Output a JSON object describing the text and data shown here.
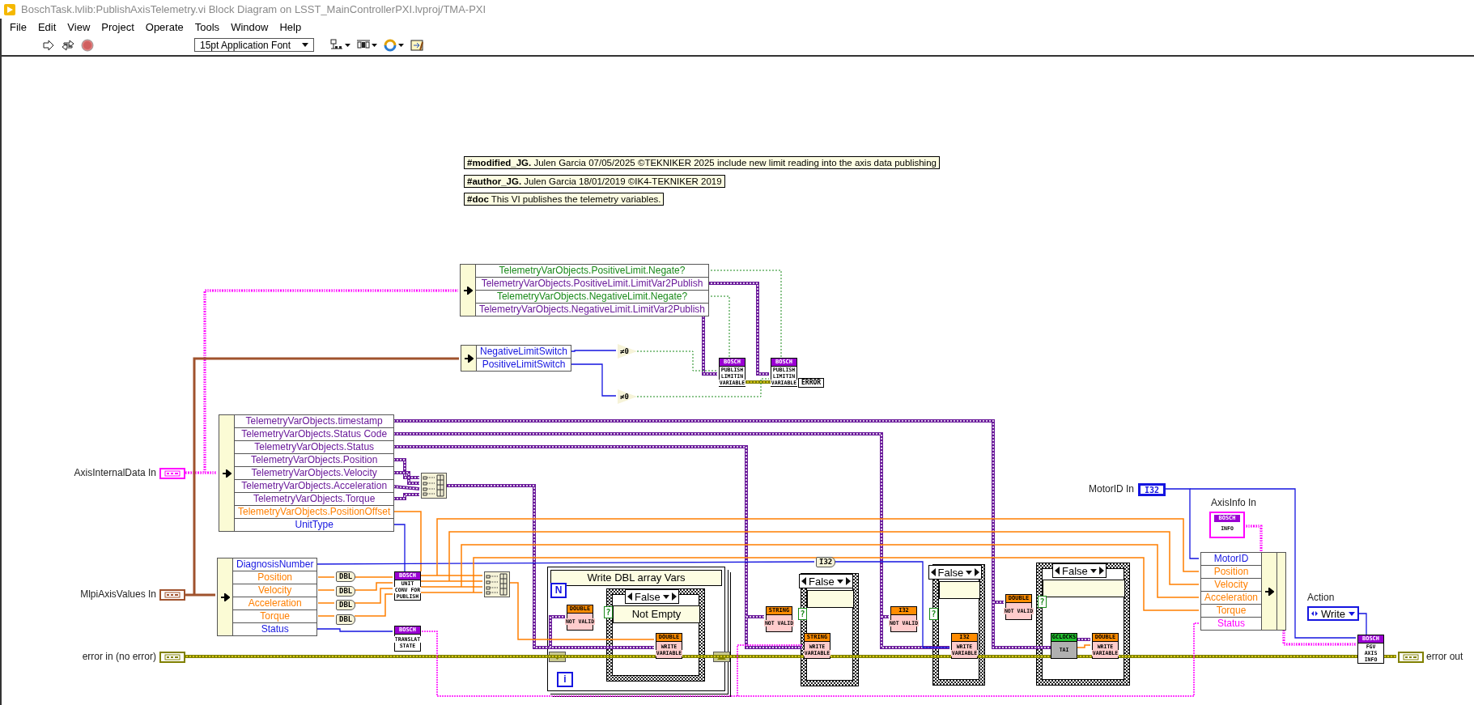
{
  "window": {
    "title": "BoschTask.lvlib:PublishAxisTelemetry.vi Block Diagram on LSST_MainControllerPXI.lvproj/TMA-PXI"
  },
  "menu": [
    "File",
    "Edit",
    "View",
    "Project",
    "Operate",
    "Tools",
    "Window",
    "Help"
  ],
  "toolbar": {
    "font": "15pt Application Font"
  },
  "diagram": {
    "comments": [
      "**#modified_JG.** Julen Garcia 07/05/2025 ©TEKNIKER 2025 include new limit reading into the axis data publishing",
      "**#author_JG.** Julen Garcia 18/01/2019 ©IK4-TEKNIKER 2019",
      "**#doc** This VI publishes the telemetry variables."
    ],
    "clusters": [
      {
        "kind": "unbundle",
        "rows": [
          {
            "label": "TelemetryVarObjects.PositiveLimit.Negate?",
            "color": "#1a8a1a"
          },
          {
            "label": "TelemetryVarObjects.PositiveLimit.LimitVar2Publish",
            "color": "#6a1a9a"
          },
          {
            "label": "TelemetryVarObjects.NegativeLimit.Negate?",
            "color": "#1a8a1a"
          },
          {
            "label": "TelemetryVarObjects.NegativeLimit.LimitVar2Publish",
            "color": "#6a1a9a"
          }
        ]
      },
      {
        "kind": "unbundle",
        "rows": [
          {
            "label": "NegativeLimitSwitch",
            "color": "#1515e0"
          },
          {
            "label": "PositiveLimitSwitch",
            "color": "#1515e0"
          }
        ]
      },
      {
        "kind": "unbundle",
        "rows": [
          {
            "label": "TelemetryVarObjects.timestamp",
            "color": "#6a1a9a"
          },
          {
            "label": "TelemetryVarObjects.Status Code",
            "color": "#6a1a9a"
          },
          {
            "label": "TelemetryVarObjects.Status",
            "color": "#6a1a9a"
          },
          {
            "label": "TelemetryVarObjects.Position",
            "color": "#6a1a9a"
          },
          {
            "label": "TelemetryVarObjects.Velocity",
            "color": "#6a1a9a"
          },
          {
            "label": "TelemetryVarObjects.Acceleration",
            "color": "#6a1a9a"
          },
          {
            "label": "TelemetryVarObjects.Torque",
            "color": "#6a1a9a"
          },
          {
            "label": "TelemetryVarObjects.PositionOffset",
            "color": "#ff7f00"
          },
          {
            "label": "UnitType",
            "color": "#1515e0"
          }
        ]
      },
      {
        "kind": "unbundle",
        "rows": [
          {
            "label": "DiagnosisNumber",
            "color": "#1515e0"
          },
          {
            "label": "Position",
            "color": "#ff7f00"
          },
          {
            "label": "Velocity",
            "color": "#ff7f00"
          },
          {
            "label": "Acceleration",
            "color": "#ff7f00"
          },
          {
            "label": "Torque",
            "color": "#ff7f00"
          },
          {
            "label": "Status",
            "color": "#1515e0"
          }
        ]
      },
      {
        "kind": "bundle",
        "rows": [
          {
            "label": "MotorID",
            "color": "#1515e0"
          },
          {
            "label": "Position",
            "color": "#ff7f00"
          },
          {
            "label": "Velocity",
            "color": "#ff7f00"
          },
          {
            "label": "Acceleration",
            "color": "#ff7f00"
          },
          {
            "label": "Torque",
            "color": "#ff7f00"
          },
          {
            "label": "Status",
            "color": "#ff00ff"
          }
        ]
      }
    ],
    "terminals": [
      {
        "label": "AxisInternalData In",
        "kind": "cluster",
        "color": "#ff00ff"
      },
      {
        "label": "MlpiAxisValues In",
        "kind": "cluster",
        "color": "#a0522d"
      },
      {
        "label": "error in (no error)",
        "kind": "cluster",
        "color": "#808000"
      },
      {
        "label": "MotorID In",
        "kind": "numeric",
        "value": "I32"
      },
      {
        "label": "AxisInfo In",
        "kind": "typedef",
        "header": "BOSCH",
        "value": "INFO"
      },
      {
        "label": "Action",
        "kind": "enum",
        "value": "Write"
      },
      {
        "label": "error out",
        "kind": "indicator",
        "color": "#808000"
      }
    ],
    "subvis": [
      {
        "kind": "bosch",
        "header": "BOSCH",
        "lines": [
          "PUBLISH",
          "LIMITIN",
          "VARIABLE"
        ]
      },
      {
        "kind": "bosch",
        "header": "BOSCH",
        "lines": [
          "PUBLISH",
          "LIMITIN",
          "VARIABLE"
        ]
      },
      {
        "kind": "bosch",
        "header": "BOSCH",
        "lines": [
          "UNIT",
          "CONV FOR",
          "PUBLISH"
        ]
      },
      {
        "kind": "bosch",
        "header": "BOSCH",
        "lines": [
          "TRANSLAT",
          "STATE"
        ]
      },
      {
        "kind": "variable",
        "header": "DOUBLE",
        "lines": [
          "NOT VALID"
        ]
      },
      {
        "kind": "variable",
        "header": "DOUBLE",
        "lines": [
          "WRITE",
          "VARIABLE"
        ]
      },
      {
        "kind": "variable",
        "header": "STRING",
        "lines": [
          "NOT VALID"
        ]
      },
      {
        "kind": "variable",
        "header": "STRING",
        "lines": [
          "WRITE",
          "VARIABLE"
        ]
      },
      {
        "kind": "variable",
        "header": "I32",
        "lines": [
          "NOT VALID"
        ]
      },
      {
        "kind": "variable",
        "header": "I32",
        "lines": [
          "WRITE",
          "VARIABLE"
        ]
      },
      {
        "kind": "variable",
        "header": "DOUBLE",
        "lines": [
          "NOT VALID"
        ]
      },
      {
        "kind": "clock",
        "header": "GCLOCKS",
        "lines": [
          "TAI"
        ]
      },
      {
        "kind": "variable",
        "header": "DOUBLE",
        "lines": [
          "WRITE",
          "VARIABLE"
        ]
      },
      {
        "kind": "bosch",
        "header": "BOSCH",
        "lines": [
          "FGV",
          "AXIS",
          "INFO"
        ]
      }
    ],
    "conversions": [
      "DBL",
      "DBL",
      "DBL",
      "DBL",
      "I32"
    ],
    "comparators": [
      "≠0",
      "≠0"
    ],
    "error_constant": "ERROR",
    "loop": {
      "title": "Write DBL array Vars",
      "count": "N",
      "index": "i"
    },
    "cases": [
      {
        "selector": "False",
        "subdiagram": "Not Empty",
        "terminal": "?"
      },
      {
        "selector": "False",
        "terminal": "?"
      },
      {
        "selector": "False",
        "terminal": "?"
      },
      {
        "selector": "False",
        "terminal": "?"
      }
    ]
  }
}
